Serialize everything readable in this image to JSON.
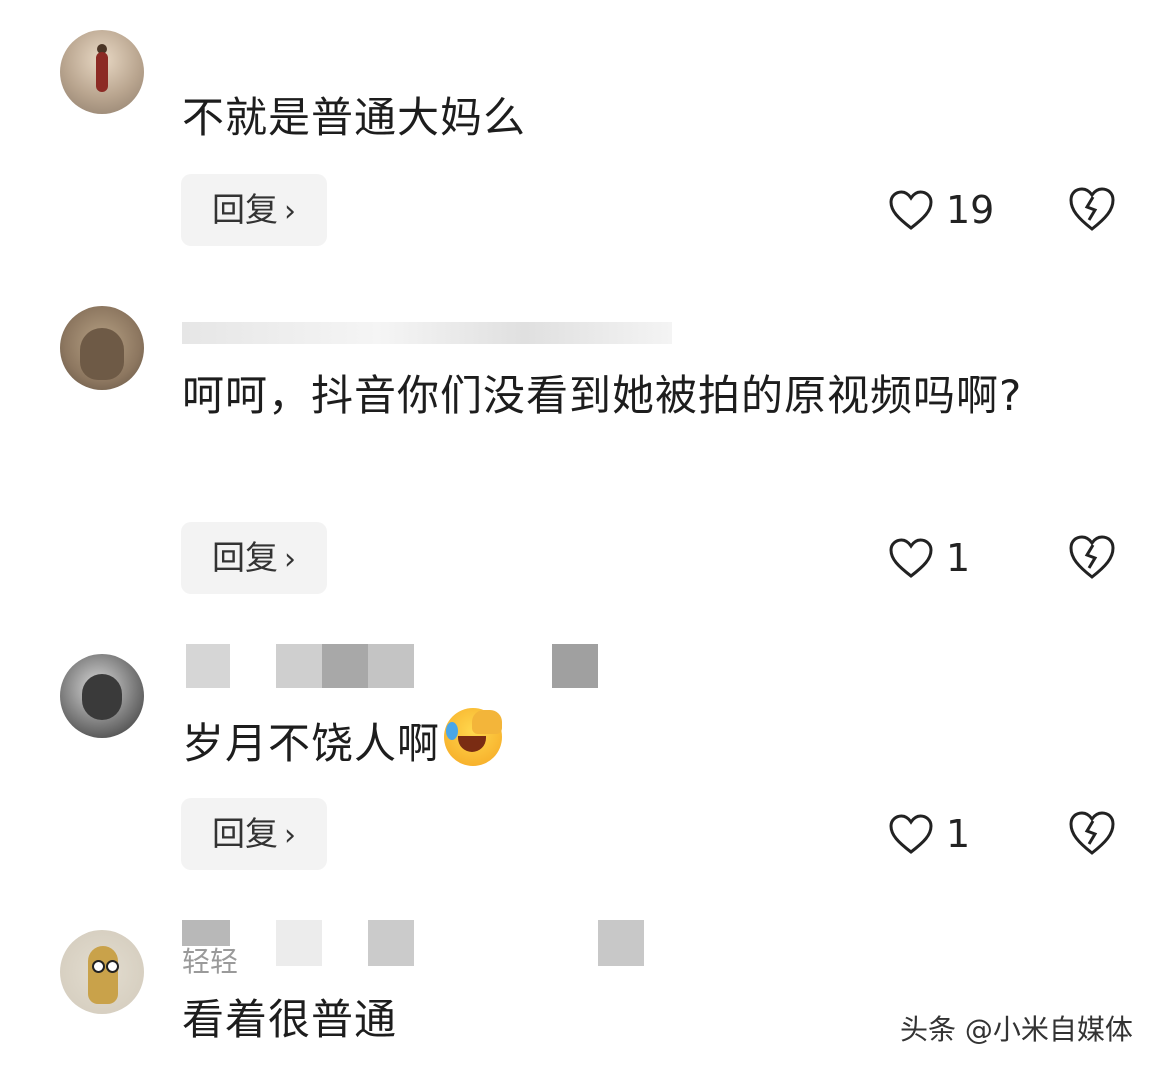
{
  "comments": [
    {
      "username": "",
      "text": "不就是普通大妈么",
      "reply_label": "回复",
      "likes": "19"
    },
    {
      "username": "",
      "text": "呵呵，抖音你们没看到她被拍的原视频吗啊?",
      "reply_label": "回复",
      "likes": "1"
    },
    {
      "username": "",
      "text": "岁月不饶人啊",
      "reply_label": "回复",
      "likes": "1"
    },
    {
      "username": "轻轻",
      "text": "看着很普通"
    }
  ],
  "watermark": "头条 @小米自媒体",
  "icons": {
    "like": "heart-outline-icon",
    "dislike": "broken-heart-icon",
    "reply_chevron": "chevron-right-icon",
    "emoji": "laughing-crying-emoji-icon"
  }
}
